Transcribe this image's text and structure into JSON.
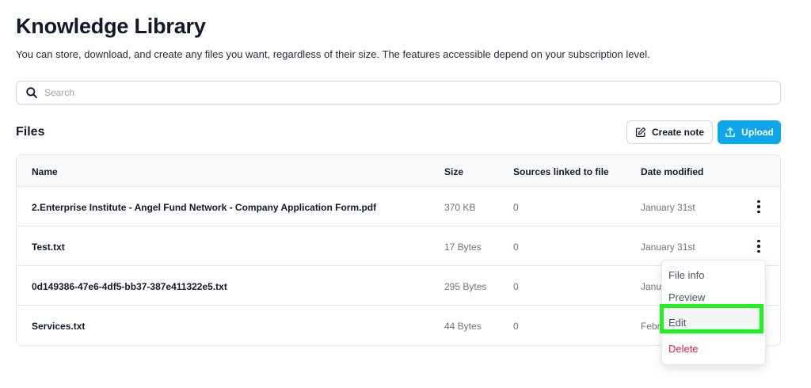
{
  "page": {
    "title": "Knowledge Library",
    "subtitle": "You can store, download, and create any files you want, regardless of their size. The features accessible depend on your subscription level."
  },
  "search": {
    "placeholder": "Search",
    "value": ""
  },
  "files_section": {
    "title": "Files",
    "create_note_label": "Create note",
    "upload_label": "Upload"
  },
  "table": {
    "columns": [
      "Name",
      "Size",
      "Sources linked to file",
      "Date modified"
    ],
    "rows": [
      {
        "name": "2.Enterprise Institute - Angel Fund Network - Company Application Form.pdf",
        "size": "370 KB",
        "sources": "0",
        "date": "January 31st"
      },
      {
        "name": "Test.txt",
        "size": "17 Bytes",
        "sources": "0",
        "date": "January 31st"
      },
      {
        "name": "0d149386-47e6-4df5-bb37-387e411322e5.txt",
        "size": "295 Bytes",
        "sources": "0",
        "date": "Janua"
      },
      {
        "name": "Services.txt",
        "size": "44 Bytes",
        "sources": "0",
        "date": "Febr"
      }
    ]
  },
  "context_menu": {
    "items": [
      "File info",
      "Preview",
      "Edit",
      "Delete"
    ]
  },
  "colors": {
    "accent": "#0ea5e9",
    "danger": "#e11d48",
    "highlight": "#1cf51c"
  },
  "icons": {
    "search": "search-icon",
    "create_note": "edit-note-icon",
    "upload": "upload-icon",
    "row_menu": "more-vertical-icon"
  }
}
